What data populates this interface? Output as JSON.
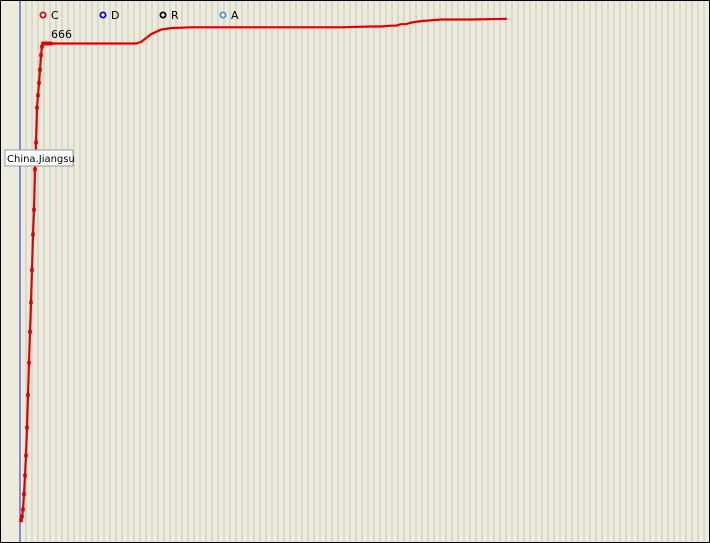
{
  "legend": [
    {
      "label": "C",
      "color": "#e00000"
    },
    {
      "label": "D",
      "color": "#0000cc"
    },
    {
      "label": "R",
      "color": "#000000"
    },
    {
      "label": "A",
      "color": "#4a8fd0"
    }
  ],
  "colors": {
    "background": "#ecebdd",
    "grid": "#c9c8b6",
    "baseline": "#1f2fbf",
    "series": "#e00000"
  },
  "current_value": "666",
  "region_label": "China.Jiangsu",
  "chart_data": {
    "type": "line",
    "title": "",
    "xlabel": "",
    "ylabel": "",
    "ylim": [
      0,
      700
    ],
    "grid": true,
    "legend_placement": "top-left",
    "series": [
      {
        "name": "C",
        "x": [
          0,
          1,
          2,
          3,
          4,
          5,
          6,
          7,
          8,
          9,
          10,
          11,
          12,
          13,
          14,
          15,
          16,
          17,
          18,
          19,
          20,
          21,
          22,
          23,
          24,
          25,
          26,
          27,
          28,
          30,
          40,
          50,
          60,
          70,
          80,
          90,
          95,
          100,
          105,
          110,
          115,
          120,
          125,
          130,
          140,
          150,
          170,
          200,
          230,
          260,
          290,
          320,
          350,
          360,
          370,
          375,
          380,
          385,
          390,
          400,
          420,
          450,
          486
        ],
        "y": [
          28,
          33,
          42,
          62,
          86,
          112,
          148,
          190,
          232,
          272,
          310,
          352,
          398,
          430,
          482,
          517,
          562,
          578,
          594,
          611,
          630,
          641,
          645,
          645,
          645,
          645,
          645,
          645,
          645,
          645,
          645,
          645,
          645,
          645,
          645,
          645,
          645,
          645,
          645,
          645,
          645,
          647,
          652,
          657,
          663,
          665,
          666,
          666,
          666,
          666,
          666,
          666,
          667,
          667,
          668,
          668,
          670,
          670,
          672,
          674,
          676,
          676,
          677
        ]
      }
    ]
  }
}
